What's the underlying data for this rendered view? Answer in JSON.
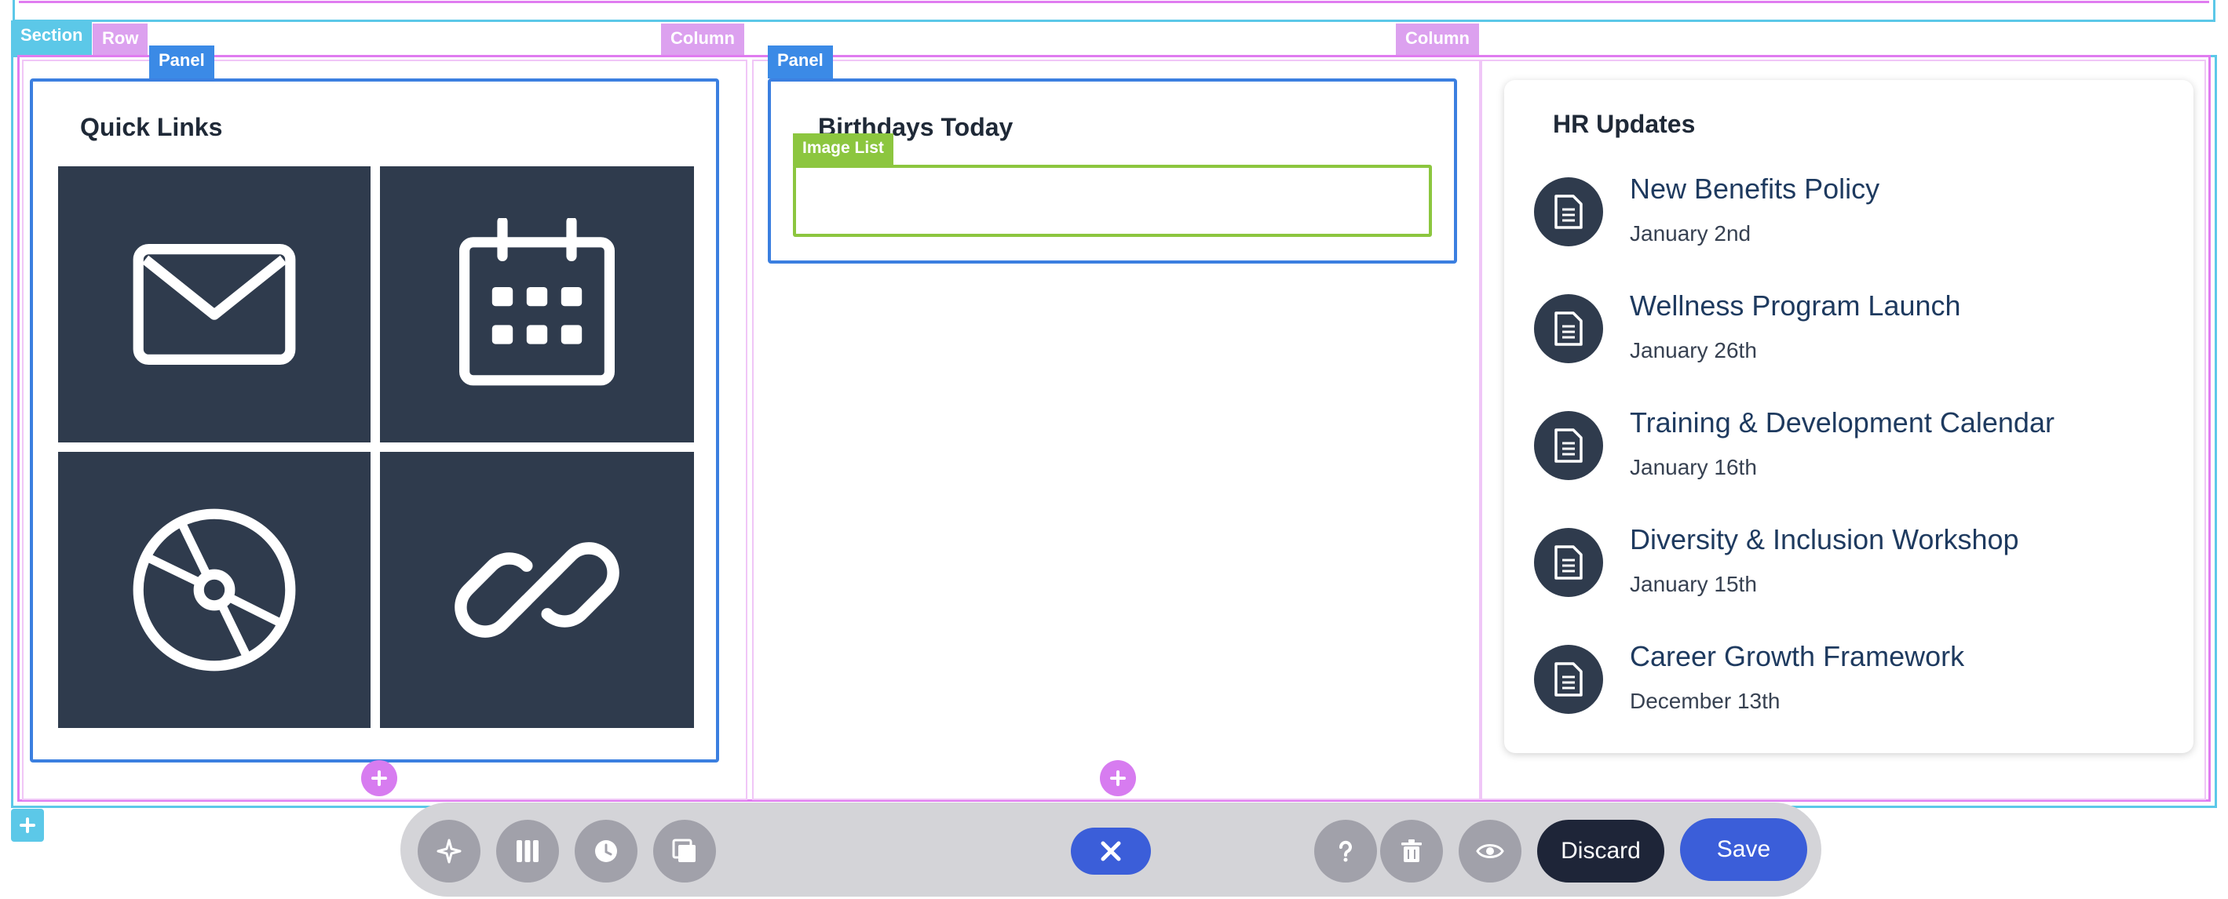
{
  "builder": {
    "section_tag": "Section",
    "row_tag": "Row",
    "column_tag_1": "Column",
    "column_tag_2": "Column",
    "panel_tag_1": "Panel",
    "panel_tag_2": "Panel",
    "image_list_tag": "Image List"
  },
  "quick_links": {
    "title": "Quick Links",
    "tiles": [
      {
        "icon": "mail-icon"
      },
      {
        "icon": "calendar-icon"
      },
      {
        "icon": "disc-icon"
      },
      {
        "icon": "link-icon"
      }
    ]
  },
  "birthdays": {
    "title": "Birthdays Today"
  },
  "hr_updates": {
    "title": "HR Updates",
    "items": [
      {
        "title": "New Benefits Policy",
        "date": "January 2nd"
      },
      {
        "title": "Wellness Program Launch",
        "date": "January 26th"
      },
      {
        "title": "Training & Development Calendar",
        "date": "January 16th"
      },
      {
        "title": "Diversity & Inclusion Workshop",
        "date": "January 15th"
      },
      {
        "title": "Career Growth Framework",
        "date": "December 13th"
      }
    ]
  },
  "toolbar": {
    "discard_label": "Discard",
    "save_label": "Save"
  },
  "colors": {
    "tile_bg": "#2f3b4d",
    "accent_blue": "#3b5ed9",
    "section_teal": "#5cc8e8",
    "row_pink": "#e07cf0",
    "panel_blue": "#3b7fe0",
    "image_list_green": "#8cc63f"
  }
}
